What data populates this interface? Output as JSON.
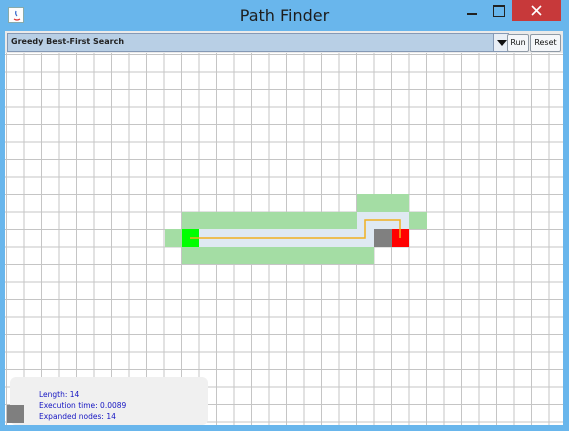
{
  "window": {
    "title": "Path Finder",
    "accent_color": "#69b6ec",
    "close_color": "#c7393a"
  },
  "toolbar": {
    "algorithm": "Greedy Best-First Search",
    "run_label": "Run",
    "reset_label": "Reset"
  },
  "legend_colors": {
    "start": "#00ff00",
    "goal": "#ff0000",
    "expanded": "#a4dda4",
    "frontier": "#dfe9f2",
    "visited": "#808080",
    "path_line": "#f0b020"
  },
  "stats": {
    "length": "Length: 14",
    "execution_time": "Execution time: 0.0089",
    "expanded_nodes": "Expanded nodes: 14"
  }
}
